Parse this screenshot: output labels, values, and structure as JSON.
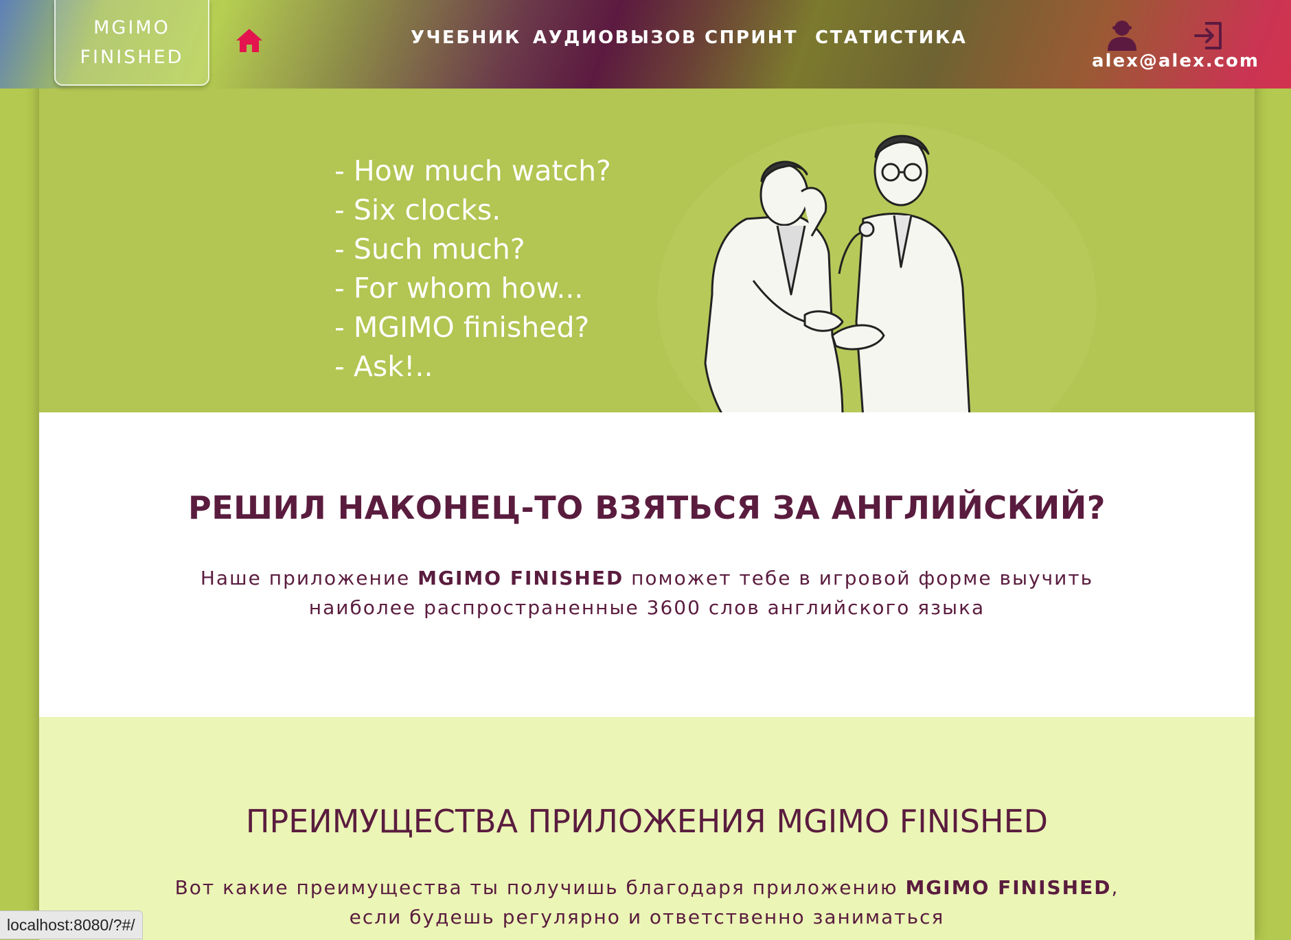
{
  "header": {
    "logo_line1": "MGIMO",
    "logo_line2": "FINISHED",
    "home_icon": "home-icon",
    "nav": {
      "textbook": "УЧЕБНИК",
      "audiocall": "АУДИОВЫЗОВ",
      "sprint": "СПРИНТ",
      "statistics": "СТАТИСТИКА"
    },
    "user_icon": "user-icon",
    "login_icon": "sign-in-icon",
    "user_email": "alex@alex.com"
  },
  "hero": {
    "dialog": [
      "- How much watch?",
      "- Six clocks.",
      "- Such much?",
      "- For whom how...",
      "- MGIMO finished?",
      "- Ask!.."
    ]
  },
  "intro": {
    "title": "РЕШИЛ НАКОНЕЦ-ТО ВЗЯТЬСЯ ЗА АНГЛИЙСКИЙ?",
    "text_before": "Наше приложение ",
    "app_name": "MGIMO FINISHED",
    "text_after": " поможет тебе в игровой форме выучить наиболее распространенные 3600 слов английского языка"
  },
  "benefits": {
    "title": "ПРЕИМУЩЕСТВА ПРИЛОЖЕНИЯ MGIMO FINISHED",
    "text_before": "Вот какие преимущества ты получишь благодаря приложению ",
    "app_name": "MGIMO FINISHED",
    "text_after": ", если будешь регулярно и ответственно заниматься"
  },
  "status_bar": {
    "url": "localhost:8080/?#/"
  },
  "colors": {
    "accent_home": "#e4144f",
    "icon_dark": "#5c1a40",
    "text_primary": "#5a1c3e",
    "page_bg": "#b4c94f",
    "hero_bg": "#b3c552",
    "benefits_bg": "#ebf5b6"
  }
}
